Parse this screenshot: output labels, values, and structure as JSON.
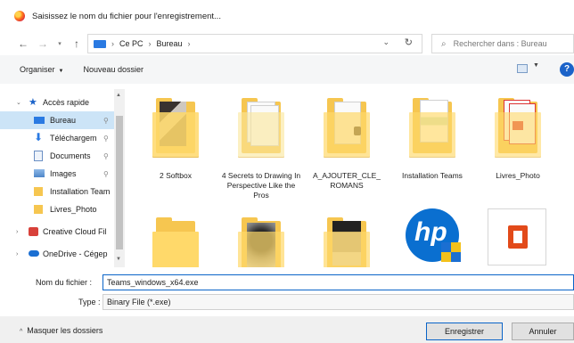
{
  "window": {
    "title": "Saisissez le nom du fichier pour l'enregistrement..."
  },
  "nav": {
    "breadcrumb": [
      "Ce PC",
      "Bureau"
    ],
    "search_placeholder": "Rechercher dans : Bureau"
  },
  "toolbar": {
    "organize": "Organiser",
    "new_folder": "Nouveau dossier"
  },
  "sidebar": {
    "items": [
      {
        "label": "Accès rapide",
        "icon": "star-icon"
      },
      {
        "label": "Bureau",
        "icon": "desktop-icon"
      },
      {
        "label": "Téléchargem",
        "icon": "download-icon"
      },
      {
        "label": "Documents",
        "icon": "documents-icon"
      },
      {
        "label": "Images",
        "icon": "images-icon"
      },
      {
        "label": "Installation Team",
        "icon": "folder-icon"
      },
      {
        "label": "Livres_Photo",
        "icon": "folder-icon"
      },
      {
        "label": "Creative Cloud Fil",
        "icon": "creative-cloud-icon"
      },
      {
        "label": "OneDrive - Cégep",
        "icon": "onedrive-icon"
      }
    ]
  },
  "files": [
    {
      "label": "2 Softbox"
    },
    {
      "label": "4 Secrets to Drawing In Perspective Like the Pros"
    },
    {
      "label": "A_AJOUTER_CLE_ ROMANS"
    },
    {
      "label": "Installation Teams"
    },
    {
      "label": "Livres_Photo"
    }
  ],
  "form": {
    "filename_label": "Nom du fichier :",
    "filename_value": "Teams_windows_x64.exe",
    "type_label": "Type :",
    "type_value": "Binary File (*.exe)"
  },
  "footer": {
    "hide_folders": "Masquer les dossiers",
    "save": "Enregistrer",
    "cancel": "Annuler"
  },
  "colors": {
    "accent": "#0a64c8",
    "folder": "#f6c650",
    "selection": "#cce4f7",
    "hp_blue": "#0a6fd0",
    "office_red": "#e24a1a"
  }
}
